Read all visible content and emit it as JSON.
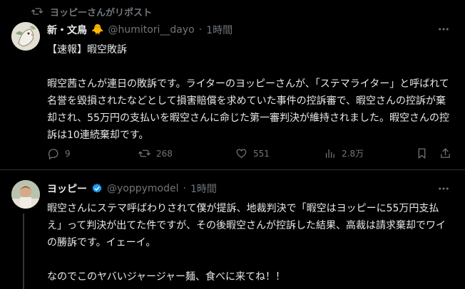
{
  "repost": {
    "label": "ヨッピーさんがリポスト"
  },
  "tweet1": {
    "display_name": "新・文鳥",
    "name_emoji": "🐥",
    "handle": "@humitori__dayo",
    "separator": "·",
    "time": "1時間",
    "text": "【速報】暇空敗訴\n\n暇空茜さんが連日の敗訴です。ライターのヨッピーさんが、「ステマライター」と呼ばれて名誉を毀損されたなどとして損害賠償を求めていた事件の控訴審で、暇空さんの控訴が棄却され、55万円の支払いを暇空さんに命じた第一審判決が維持されました。暇空さんの控訴は10連続棄却です。",
    "actions": {
      "replies": "9",
      "reposts": "268",
      "likes": "551",
      "views": "2.8万"
    }
  },
  "tweet2": {
    "display_name": "ヨッピー",
    "handle": "@yoppymodel",
    "separator": "·",
    "time": "1時間",
    "text": "暇空さんにステマ呼ばわりされて僕が提訴、地裁判決で「暇空はヨッピーに55万円支払え」って判決が出てた件ですが、その後暇空さんが控訴した結果、高裁は請求棄却でワイの勝訴です。イェーイ。\n\nなのでこのヤバいジャージャー麺、食べに来てね！！"
  },
  "colors": {
    "background": "#000000",
    "text": "#e7e9ea",
    "muted": "#71767b",
    "verified": "#1d9bf0",
    "divider": "#2f3336"
  },
  "icons": [
    "repost-icon",
    "more-icon",
    "reply-icon",
    "like-icon",
    "views-icon",
    "bookmark-icon",
    "share-icon",
    "verified-badge-icon"
  ]
}
